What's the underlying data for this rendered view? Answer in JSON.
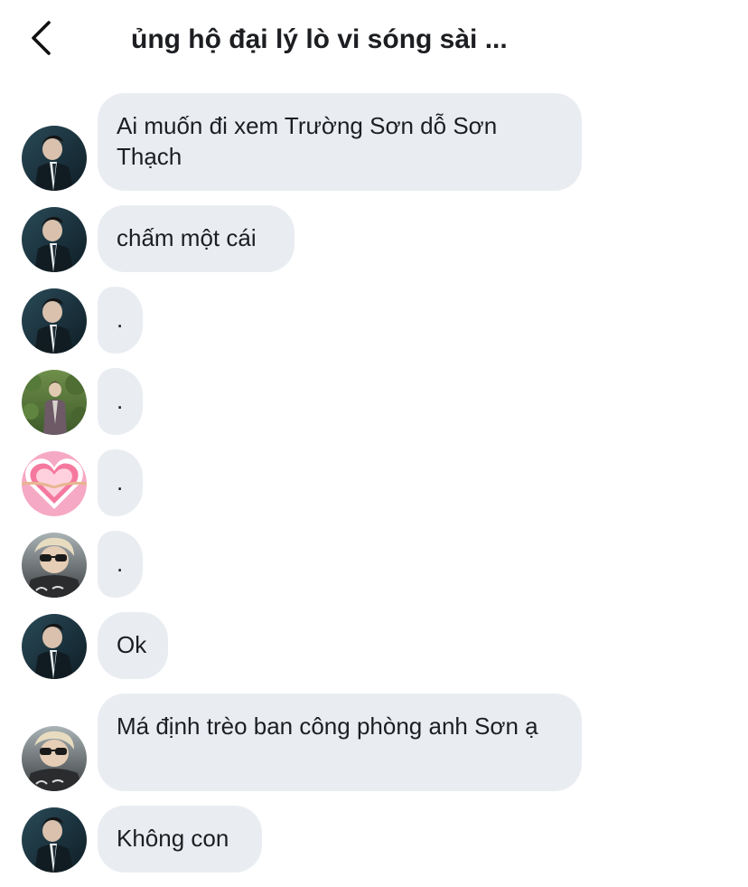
{
  "header": {
    "title": "ủng hộ đại lý lò vi sóng sài ..."
  },
  "messages": [
    {
      "avatar": "man-in-suit-avatar",
      "text": "Ai muốn đi xem Trường Sơn dỗ Sơn Thạch"
    },
    {
      "avatar": "man-in-suit-avatar",
      "text": "chấm một cái"
    },
    {
      "avatar": "man-in-suit-avatar",
      "text": "."
    },
    {
      "avatar": "man-in-garden-avatar",
      "text": "."
    },
    {
      "avatar": "pink-heart-avatar",
      "text": "."
    },
    {
      "avatar": "man-with-sunglasses-avatar",
      "text": "."
    },
    {
      "avatar": "man-in-suit-avatar",
      "text": "Ok"
    },
    {
      "avatar": "man-with-sunglasses-avatar",
      "text": "Má định trèo ban công phòng anh Sơn ạ"
    },
    {
      "avatar": "man-in-suit-avatar",
      "text": "Không con"
    }
  ],
  "colors": {
    "bubble": "#e9edf2",
    "text": "#1c1e21",
    "background": "#ffffff"
  }
}
